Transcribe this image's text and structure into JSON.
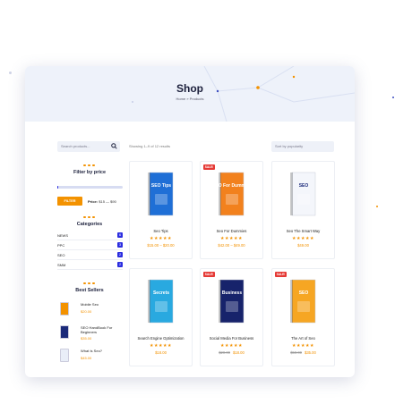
{
  "page": {
    "title": "Shop",
    "breadcrumb": "Home » Products"
  },
  "search": {
    "placeholder": "Search products..."
  },
  "results_text": "Showing 1–9 of 12 results",
  "sort": {
    "selected": "Sort by popularity"
  },
  "filter": {
    "title": "Filter by price",
    "button": "FILTER",
    "price_label": "Price:",
    "price_range": "$15 — $90",
    "slider_fraction": 0.0
  },
  "categories": {
    "title": "Categories",
    "items": [
      {
        "name": "NEWS",
        "count": "6"
      },
      {
        "name": "PPC",
        "count": "3"
      },
      {
        "name": "SEO",
        "count": "2"
      },
      {
        "name": "SMM",
        "count": "2"
      }
    ]
  },
  "best_sellers": {
    "title": "Best Sellers",
    "items": [
      {
        "name": "Mobile Seo",
        "price": "$20.00"
      },
      {
        "name": "SEO HandBook For Beginners",
        "price": "$35.00"
      },
      {
        "name": "What Is Seo?",
        "price": "$45.00"
      }
    ]
  },
  "products": [
    {
      "name": "Seo Tips",
      "price": "$15.00 – $20.00",
      "old_price": "",
      "sale": "",
      "cover_title": "SEO Tips",
      "cover_color": "#1f6fd6",
      "cover_text": "#ffffff"
    },
    {
      "name": "Seo For Dummies",
      "price": "$42.00 – $49.00",
      "old_price": "",
      "sale": "SALE!",
      "cover_title": "SEO For Dummies",
      "cover_color": "#f2811d",
      "cover_text": "#ffffff"
    },
    {
      "name": "Seo The Smart Way",
      "price": "$49.00",
      "old_price": "",
      "sale": "",
      "cover_title": "SEO",
      "cover_color": "#f4f6fb",
      "cover_text": "#1b2a7a"
    },
    {
      "name": "Search Engine Optimization",
      "price": "$18.00",
      "old_price": "",
      "sale": "",
      "cover_title": "Secrets",
      "cover_color": "#29a9e0",
      "cover_text": "#ffffff"
    },
    {
      "name": "Social Media For Business",
      "price": "$18.00",
      "old_price": "$20.00",
      "sale": "SALE!",
      "cover_title": "Business",
      "cover_color": "#17236b",
      "cover_text": "#ffffff"
    },
    {
      "name": "The Art of Seo",
      "price": "$35.00",
      "old_price": "$50.00",
      "sale": "SALE!",
      "cover_title": "SEO",
      "cover_color": "#f6a623",
      "cover_text": "#ffffff"
    }
  ],
  "stars": "★★★★★",
  "colors": {
    "accent": "#f39200",
    "primary": "#2c2ee0",
    "sale": "#e53935",
    "banner": "#eef2fa"
  }
}
